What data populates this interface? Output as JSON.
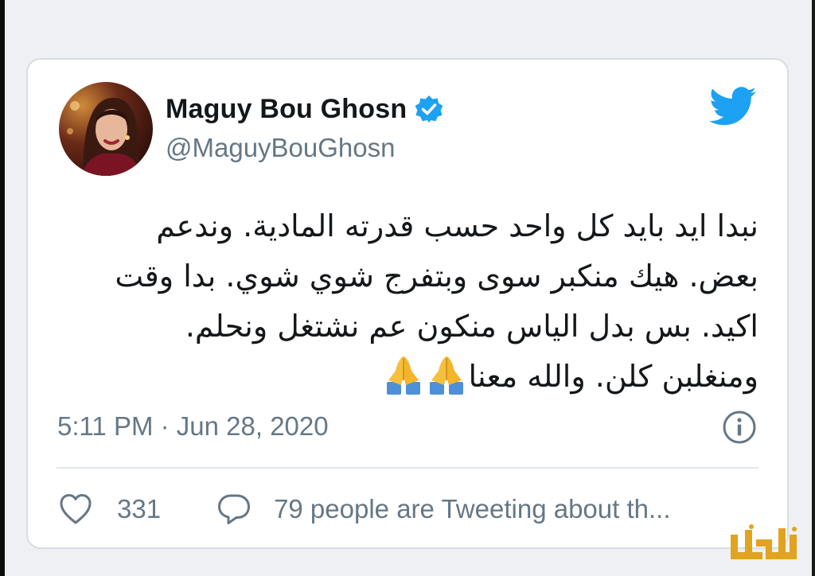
{
  "tweet": {
    "author": {
      "display_name": "Maguy Bou Ghosn",
      "handle": "@MaguyBouGhosn",
      "verified": true
    },
    "text_lines": [
      "نبدا ايد بايد كل واحد حسب قدرته المادية. وندعم",
      "بعض. هيك منكبر سوى  وبتفرج شوي شوي. بدا وقت",
      "اكيد. بس بدل الياس منكون عم نشتغل ونحلم.",
      "ومنغلبن كلن. والله معنا"
    ],
    "emoji": "folded-hands",
    "timestamp": "5:11 PM · Jun 28, 2020",
    "like_count": "331",
    "tweeting_text": "79 people are Tweeting about th..."
  },
  "icons": {
    "logo": "twitter-bird-icon",
    "verified": "verified-badge-icon",
    "info": "info-icon",
    "like": "heart-icon",
    "reply": "reply-icon"
  },
  "colors": {
    "twitter_blue": "#1da1f2",
    "text_primary": "#14171a",
    "text_secondary": "#657786",
    "border": "#d6dde3",
    "watermark": "#e2a31e"
  }
}
